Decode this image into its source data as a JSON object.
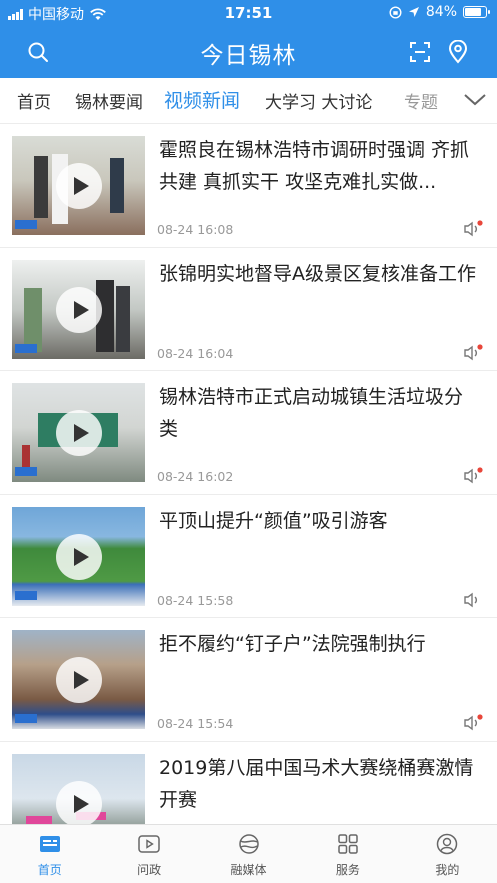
{
  "status_bar": {
    "carrier": "中国移动",
    "time": "17:51",
    "battery": "84%",
    "battery_level": 0.84
  },
  "header": {
    "title": "今日锡林",
    "search_icon": "search-icon",
    "scan_icon": "scan-icon",
    "location_icon": "location-icon"
  },
  "tabs": [
    {
      "label": "首页"
    },
    {
      "label": "锡林要闻"
    },
    {
      "label": "视频新闻"
    },
    {
      "label": "大学习 大讨论"
    },
    {
      "label": "专题"
    }
  ],
  "active_tab": "视频新闻",
  "news": [
    {
      "title": "霍照良在锡林浩特市调研时强调 齐抓共建 真抓实干 攻坚克难扎实做...",
      "time": "08-24 16:08"
    },
    {
      "title": "张锦明实地督导A级景区复核准备工作",
      "time": "08-24 16:04"
    },
    {
      "title": "锡林浩特市正式启动城镇生活垃圾分类",
      "time": "08-24 16:02"
    },
    {
      "title": "平顶山提升“颜值”吸引游客",
      "time": "08-24 15:58"
    },
    {
      "title": "拒不履约“钉子户”法院强制执行",
      "time": "08-24 15:54"
    },
    {
      "title": "2019第八届中国马术大赛绕桶赛激情开赛",
      "time": ""
    }
  ],
  "tabbar": [
    {
      "label": "首页",
      "icon": "home-icon"
    },
    {
      "label": "问政",
      "icon": "play-box-icon"
    },
    {
      "label": "融媒体",
      "icon": "globe-icon"
    },
    {
      "label": "服务",
      "icon": "grid-icon"
    },
    {
      "label": "我的",
      "icon": "user-icon"
    }
  ],
  "colors": {
    "accent": "#2f8fe8",
    "text": "#222222",
    "muted": "#999999"
  }
}
